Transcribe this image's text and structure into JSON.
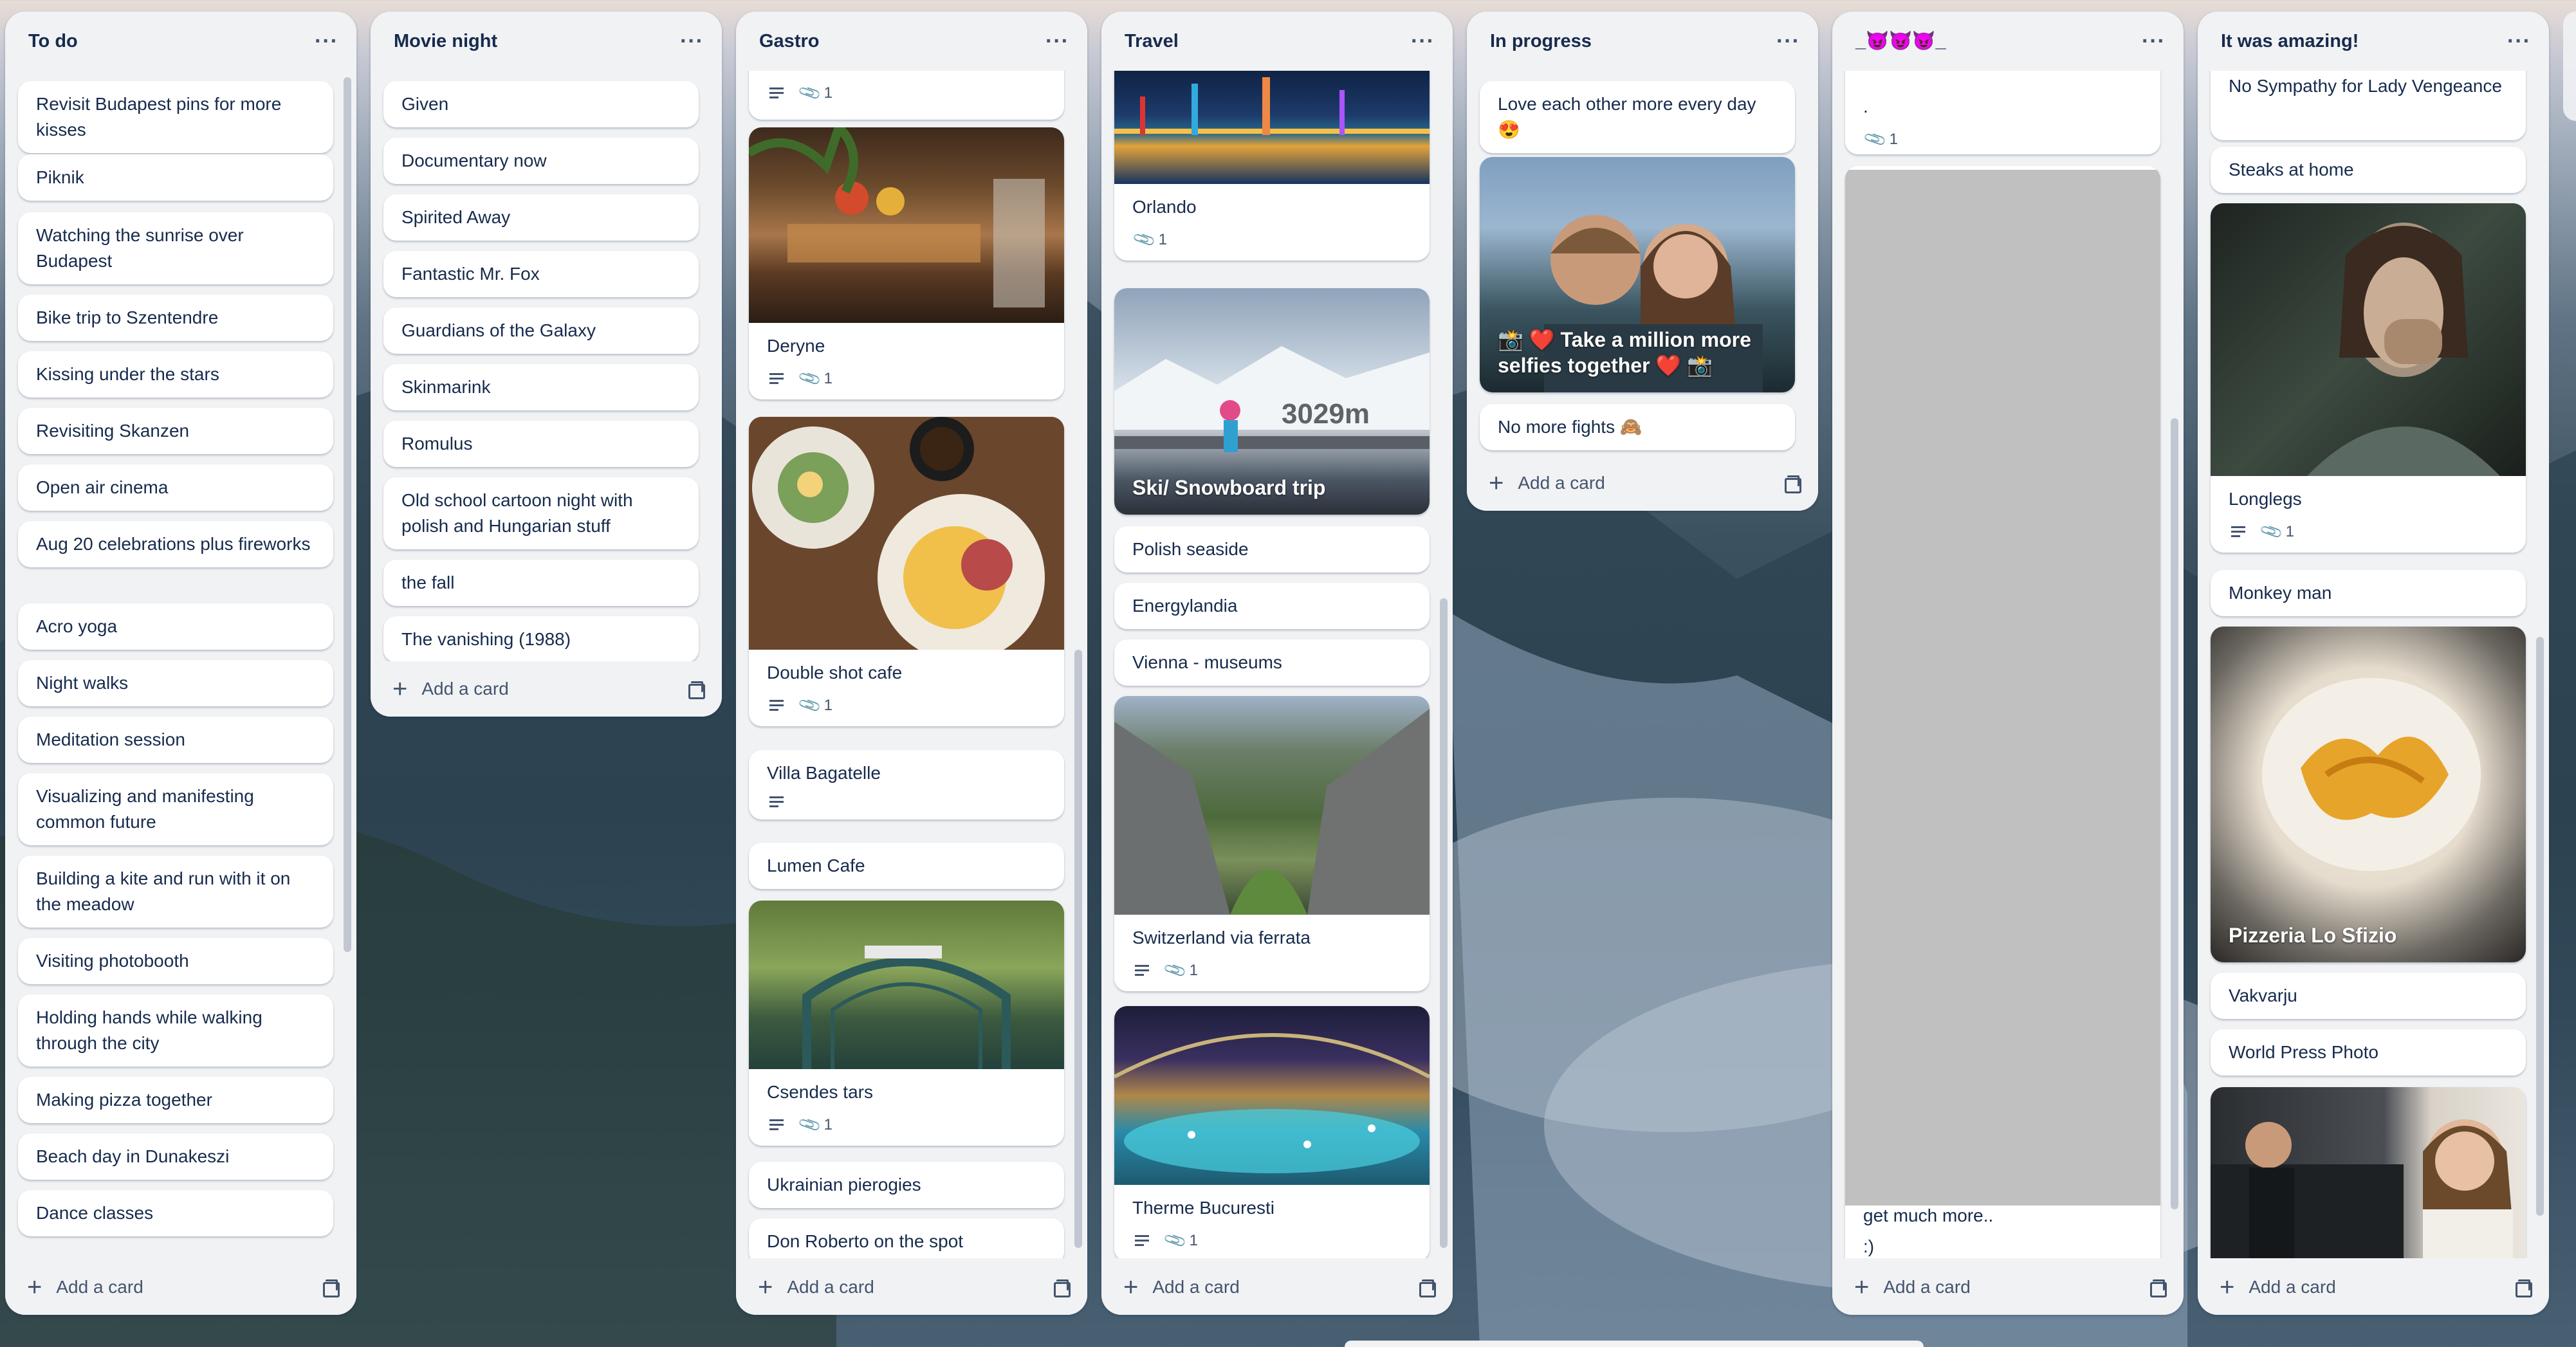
{
  "lists": [
    {
      "title": "To do",
      "add_label": "Add a card",
      "cards": [
        "Revisit Budapest pins for more kisses",
        "Piknik",
        "Watching the sunrise over Budapest",
        "Bike trip to Szentendre",
        "Kissing under the stars",
        "Revisiting Skanzen",
        "Open air cinema",
        "Aug 20 celebrations plus fireworks",
        "Acro yoga",
        "Night walks",
        "Meditation session",
        "Visualizing and manifesting common future",
        "Building a kite and run with it on the meadow",
        "Visiting photobooth",
        "Holding hands while walking through the city",
        "Making pizza together",
        "Beach day in Dunakeszi",
        "Dance classes"
      ]
    },
    {
      "title": "Movie night",
      "add_label": "Add a card",
      "cards": [
        "Given",
        "Documentary now",
        "Spirited Away",
        "Fantastic Mr. Fox",
        "Guardians of the Galaxy",
        "Skinmarink",
        "Romulus",
        "Old school cartoon night with polish and Hungarian stuff",
        "the fall",
        "The vanishing (1988)"
      ]
    },
    {
      "title": "Gastro",
      "add_label": "Add a card",
      "cards": [
        {
          "title": "",
          "attachments": "1"
        },
        {
          "title": "Deryne",
          "attachments": "1"
        },
        {
          "title": "Double shot cafe",
          "attachments": "1"
        },
        {
          "title": "Villa Bagatelle"
        },
        {
          "title": "Lumen Cafe"
        },
        {
          "title": "Csendes tars",
          "attachments": "1"
        },
        {
          "title": "Ukrainian pierogies"
        },
        {
          "title": "Don Roberto on the spot"
        }
      ]
    },
    {
      "title": "Travel",
      "add_label": "Add a card",
      "cards": [
        {
          "title": "Orlando",
          "attachments": "1"
        },
        {
          "title": "Ski/ Snowboard trip",
          "cover_text": "3029m"
        },
        {
          "title": "Polish seaside"
        },
        {
          "title": "Energylandia"
        },
        {
          "title": "Vienna - museums"
        },
        {
          "title": "Switzerland via ferrata",
          "attachments": "1"
        },
        {
          "title": "Therme Bucuresti",
          "attachments": "1"
        }
      ]
    },
    {
      "title": "In progress",
      "add_label": "Add a card",
      "cards": [
        {
          "title": "Love each other more every day 😍"
        },
        {
          "title": "📸 ❤️ Take a million more selfies together ❤️ 📸"
        },
        {
          "title": "No more fights 🙈"
        }
      ]
    },
    {
      "title": "_😈😈😈_",
      "add_label": "Add a card",
      "cards": [
        {
          "title": ".",
          "attachments": "1"
        },
        {
          "title": "get much more..",
          "extra": ":)"
        }
      ]
    },
    {
      "title": "It was amazing!",
      "add_label": "Add a card",
      "cards": [
        {
          "title": "No Sympathy for Lady Vengeance"
        },
        {
          "title": "Steaks at home"
        },
        {
          "title": "Longlegs",
          "attachments": "1"
        },
        {
          "title": "Monkey man"
        },
        {
          "title": "Pizzeria Lo Sfizio"
        },
        {
          "title": "Vakvarju"
        },
        {
          "title": "World Press Photo"
        }
      ]
    }
  ],
  "colors": {
    "list_bg": "#f1f2f4",
    "card_bg": "#ffffff",
    "text": "#172b4d",
    "muted": "#44546f"
  },
  "icons": {
    "more": "ellipsis-icon",
    "add": "plus-icon",
    "template": "card-template-icon",
    "description": "description-icon",
    "attachment": "paperclip-icon"
  }
}
